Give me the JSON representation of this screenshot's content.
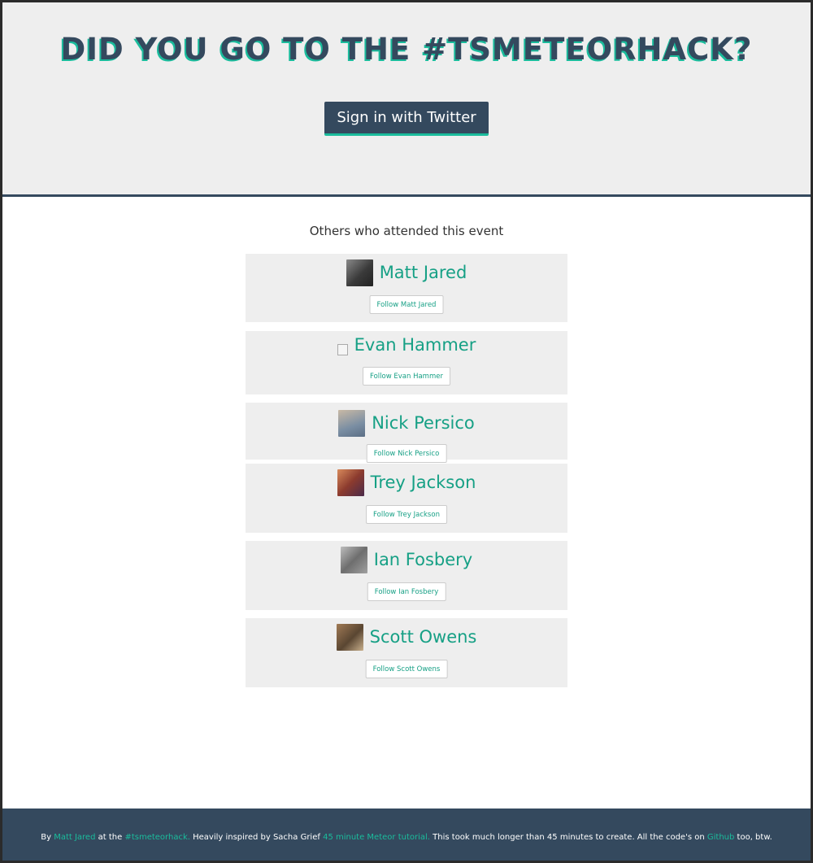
{
  "hero": {
    "title": "DID YOU GO TO THE #TSMETEORHACK?",
    "signin_label": "Sign in with Twitter"
  },
  "attendees_section": {
    "title": "Others who attended this event"
  },
  "attendees": [
    {
      "name": "Matt Jared",
      "follow_label": "Follow Matt Jared",
      "avatar": "photo"
    },
    {
      "name": "Evan Hammer",
      "follow_label": "Follow Evan Hammer",
      "avatar": "broken-image"
    },
    {
      "name": "Nick Persico",
      "follow_label": "Follow Nick Persico",
      "avatar": "photo"
    },
    {
      "name": "Trey Jackson",
      "follow_label": "Follow Trey Jackson",
      "avatar": "photo"
    },
    {
      "name": "Ian Fosbery",
      "follow_label": "Follow Ian Fosbery",
      "avatar": "photo"
    },
    {
      "name": "Scott Owens",
      "follow_label": "Follow Scott Owens",
      "avatar": "photo"
    }
  ],
  "footer": {
    "by": "By",
    "author_link": "Matt Jared",
    "at_the": "at the",
    "event_link": "#tsmeteorhack.",
    "inspired": "Heavily inspired by Sacha Grief",
    "tutorial_link": "45 minute Meteor tutorial.",
    "rest": "This took much longer than 45 minutes to create. All the code's on",
    "github_link": "Github",
    "end": "too, btw."
  },
  "colors": {
    "navy": "#34495e",
    "teal": "#1abc9c",
    "panel": "#eeeeee"
  }
}
